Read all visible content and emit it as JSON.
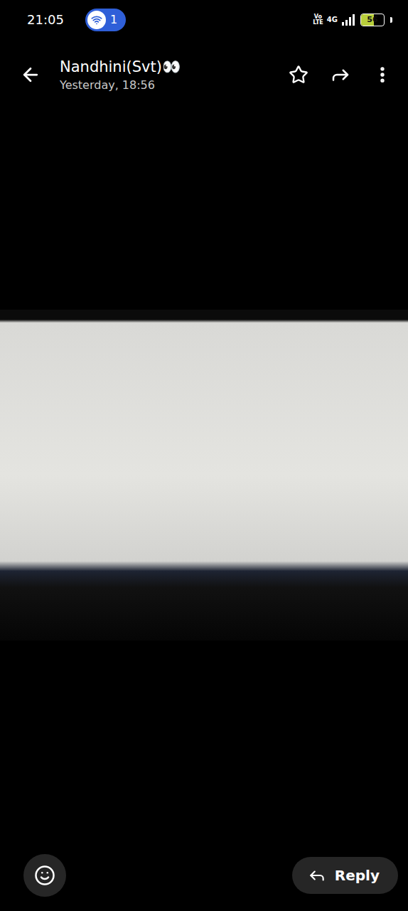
{
  "status_bar": {
    "time": "21:05",
    "notification_count": "1",
    "network": {
      "volte_top": "Vo",
      "volte_bottom": "LTE",
      "type": "4G"
    },
    "battery": {
      "reading": "56",
      "level": 0.56
    }
  },
  "header": {
    "contact": "Nandhini(Svt)👀",
    "timestamp": "Yesterday, 18:56",
    "starred": false
  },
  "footer": {
    "reply_label": "Reply"
  }
}
